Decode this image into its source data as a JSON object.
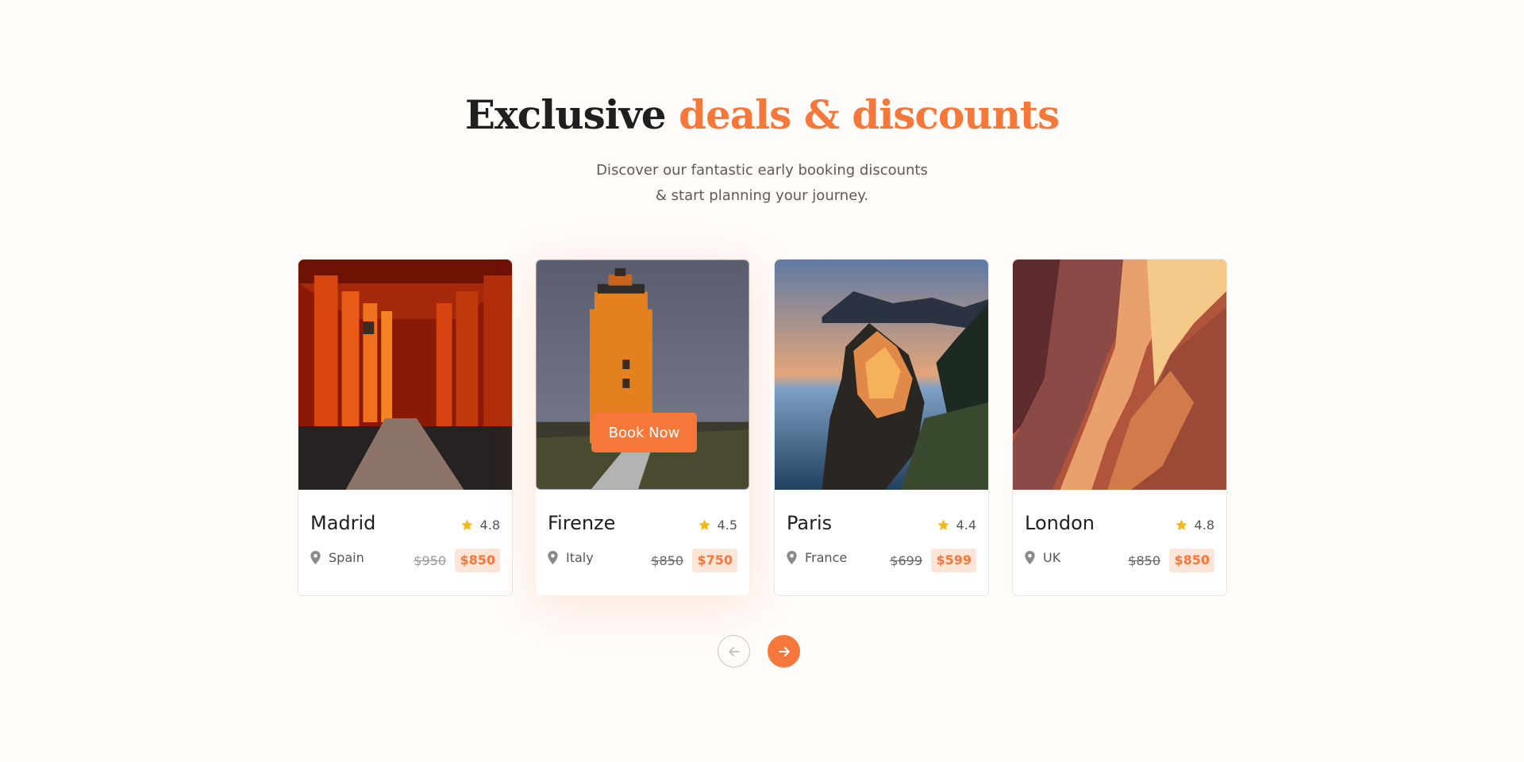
{
  "heading": {
    "part1": "Exclusive",
    "part2": "deals & discounts"
  },
  "subtitle": {
    "line1": "Discover our fantastic early booking discounts",
    "line2": "& start planning your journey."
  },
  "cards": [
    {
      "city": "Madrid",
      "country": "Spain",
      "rating": "4.8",
      "old_price": "$950",
      "new_price": "$850"
    },
    {
      "city": "Firenze",
      "country": "Italy",
      "rating": "4.5",
      "old_price": "$850",
      "new_price": "$750",
      "cta": "Book Now"
    },
    {
      "city": "Paris",
      "country": "France",
      "rating": "4.4",
      "old_price": "$699",
      "new_price": "$599"
    },
    {
      "city": "London",
      "country": "UK",
      "rating": "4.8",
      "old_price": "$850",
      "new_price": "$850"
    }
  ],
  "colors": {
    "accent": "#f6773a",
    "star": "#f5b81c",
    "price_bg": "#fde5d8"
  },
  "icons": {
    "rating": "star-icon",
    "location": "map-pin-icon",
    "prev": "arrow-left-icon",
    "next": "arrow-right-icon"
  }
}
